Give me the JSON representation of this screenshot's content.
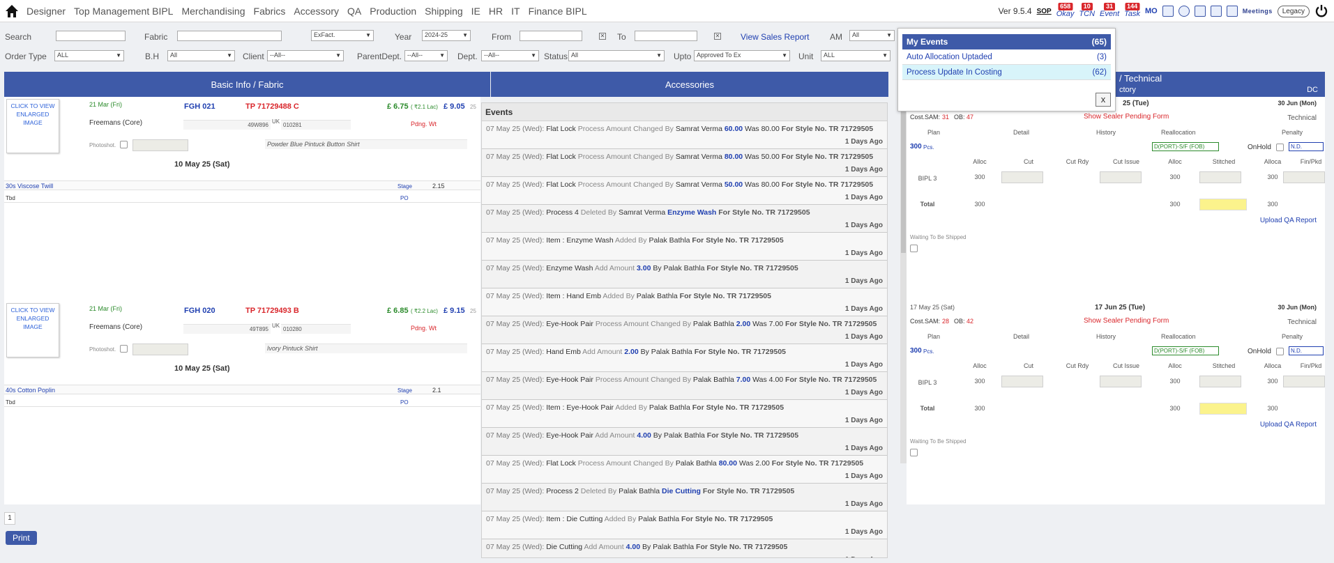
{
  "nav": {
    "items": [
      "Designer",
      "Top Management BIPL",
      "Merchandising",
      "Fabrics",
      "Accessory",
      "QA",
      "Production",
      "Shipping",
      "IE",
      "HR",
      "IT",
      "Finance BIPL"
    ],
    "version": "Ver 9.5.4",
    "sop": "SOP",
    "badges": [
      {
        "label": "Okay",
        "count": "658"
      },
      {
        "label": "TCN",
        "count": "10"
      },
      {
        "label": "Event",
        "count": "31"
      },
      {
        "label": "Task",
        "count": "144"
      }
    ],
    "mo": "MO",
    "meetings": "Meetings",
    "legacy": "Legacy"
  },
  "filters": {
    "search": "Search",
    "fabric": "Fabric",
    "exfact": "ExFact.",
    "year": "Year",
    "year_val": "2024-25",
    "from": "From",
    "to": "To",
    "view_sales": "View Sales Report",
    "am": "AM",
    "am_val": "All",
    "order_type": "Order Type",
    "order_type_val": "ALL",
    "bh": "B.H",
    "bh_val": "All",
    "client": "Client",
    "client_val": "--All--",
    "parent": "ParentDept.",
    "parent_val": "--All--",
    "dept": "Dept.",
    "dept_val": "--All--",
    "status": "Status",
    "status_val": "All",
    "upto": "Upto",
    "upto_val": "Approved To Ex",
    "unit": "Unit",
    "unit_val": "ALL"
  },
  "headers": {
    "basic": "Basic Info / Fabric",
    "acc": "Accessories",
    "tech": "/ Technical",
    "factory": "ctory",
    "dc": "DC"
  },
  "orders": [
    {
      "thumb": "CLICK TO VIEW ENLARGED IMAGE",
      "date": "21 Mar (Fri)",
      "code": "FGH 021",
      "tp": "TP 71729488 C",
      "price1": "£ 6.75",
      "price1_sub": "( ₹2.1 Lac)",
      "price2": "£ 9.05",
      "price2_sub": "25",
      "client": "Freemans (Core)",
      "ref": "49W896",
      "cty": "UK",
      "num": "010281",
      "pdng": "Pdng. Wt",
      "photoshot": "Photoshot.",
      "desc": "Powder Blue Pintuck Button Shirt",
      "exdate": "10 May 25 (Sat)",
      "fabric": "30s Viscose Twill",
      "stage": "Stage",
      "stage_val": "2.15",
      "tbd": "Tbd",
      "po": "PO",
      "t": {
        "d1": "",
        "d2": "25 (Tue)",
        "d3": "30 Jun (Mon)",
        "sam": "Cost.SAM:",
        "sam_v": "31",
        "ob": "OB:",
        "ob_v": "47",
        "sealer": "Show Sealer Pending Form",
        "tech": "Technical",
        "plan": "Plan",
        "detail": "Detail",
        "history": "History",
        "realloc": "Reallocation",
        "penalty": "Penalty",
        "pcs": "300",
        "pcs_u": "Pcs.",
        "dport": "D(PORT)-S/F (FOB)",
        "onhold": "OnHold",
        "nd": "N.D.",
        "cols": [
          "Alloc",
          "Cut",
          "Cut Rdy",
          "Cut Issue",
          "Alloc",
          "Stitched",
          "Alloca",
          "Fin/Pkd"
        ],
        "bipl": "BIPL 3",
        "v1": "300",
        "v2": "300",
        "v3": "300",
        "total": "Total",
        "tv1": "300",
        "tv2": "300",
        "tv3": "300",
        "upload": "Upload QA Report",
        "waiting": "Waiting To Be Shipped"
      }
    },
    {
      "thumb": "CLICK TO VIEW ENLARGED IMAGE",
      "date": "21 Mar (Fri)",
      "code": "FGH 020",
      "tp": "TP 71729493 B",
      "price1": "£ 6.85",
      "price1_sub": "( ₹2.2 Lac)",
      "price2": "£ 9.15",
      "price2_sub": "25",
      "client": "Freemans (Core)",
      "ref": "49T895",
      "cty": "UK",
      "num": "010280",
      "pdng": "Pdng. Wt",
      "photoshot": "Photoshot.",
      "desc": "Ivory Pintuck Shirt",
      "exdate": "10 May 25 (Sat)",
      "fabric": "40s Cotton Poplin",
      "stage": "Stage",
      "stage_val": "2.1",
      "tbd": "Tbd",
      "po": "PO",
      "t": {
        "d1": "17 May 25 (Sat)",
        "d2": "17 Jun 25 (Tue)",
        "d3": "30 Jun (Mon)",
        "sam": "Cost.SAM:",
        "sam_v": "28",
        "ob": "OB:",
        "ob_v": "42",
        "sealer": "Show Sealer Pending Form",
        "tech": "Technical",
        "plan": "Plan",
        "detail": "Detail",
        "history": "History",
        "realloc": "Reallocation",
        "penalty": "Penalty",
        "pcs": "300",
        "pcs_u": "Pcs.",
        "dport": "D(PORT)-S/F (FOB)",
        "onhold": "OnHold",
        "nd": "N.D.",
        "cols": [
          "Alloc",
          "Cut",
          "Cut Rdy",
          "Cut Issue",
          "Alloc",
          "Stitched",
          "Alloca",
          "Fin/Pkd"
        ],
        "bipl": "BIPL 3",
        "v1": "300",
        "v2": "300",
        "v3": "300",
        "total": "Total",
        "tv1": "300",
        "tv2": "300",
        "tv3": "300",
        "upload": "Upload QA Report",
        "waiting": "Waiting To Be Shipped"
      }
    }
  ],
  "events": {
    "title": "Events",
    "ago": "1 Days Ago",
    "items": [
      {
        "d": "07 May 25 (Wed):",
        "p1": "Flat Lock",
        "a": "Process Amount Changed By",
        "u": "Samrat Verma",
        "v": "60.00",
        "w": "Was 80.00",
        "s": "For Style No. TR 71729505"
      },
      {
        "d": "07 May 25 (Wed):",
        "p1": "Flat Lock",
        "a": "Process Amount Changed By",
        "u": "Samrat Verma",
        "v": "80.00",
        "w": "Was 50.00",
        "s": "For Style No. TR 71729505"
      },
      {
        "d": "07 May 25 (Wed):",
        "p1": "Flat Lock",
        "a": "Process Amount Changed By",
        "u": "Samrat Verma",
        "v": "50.00",
        "w": "Was 80.00",
        "s": "For Style No. TR 71729505"
      },
      {
        "d": "07 May 25 (Wed):",
        "p1": "Process 4",
        "a": "Deleted By",
        "u": "Samrat Verma",
        "v": "Enzyme Wash",
        "w": "",
        "s": "For Style No. TR 71729505"
      },
      {
        "d": "07 May 25 (Wed):",
        "p1": "Item : Enzyme Wash",
        "a": "Added By",
        "u": "Palak Bathla",
        "v": "",
        "w": "",
        "s": "For Style No. TR 71729505"
      },
      {
        "d": "07 May 25 (Wed):",
        "p1": "Enzyme Wash",
        "a": "Add Amount",
        "u": "",
        "v": "3.00",
        "w": "By Palak Bathla",
        "s": "For Style No. TR 71729505"
      },
      {
        "d": "07 May 25 (Wed):",
        "p1": "Item : Hand Emb",
        "a": "Added By",
        "u": "Palak Bathla",
        "v": "",
        "w": "",
        "s": "For Style No. TR 71729505"
      },
      {
        "d": "07 May 25 (Wed):",
        "p1": "Eye-Hook Pair",
        "a": "Process Amount Changed By",
        "u": "Palak Bathla",
        "v": "2.00",
        "w": "Was 7.00",
        "s": "For Style No. TR 71729505"
      },
      {
        "d": "07 May 25 (Wed):",
        "p1": "Hand Emb",
        "a": "Add Amount",
        "u": "",
        "v": "2.00",
        "w": "By Palak Bathla",
        "s": "For Style No. TR 71729505"
      },
      {
        "d": "07 May 25 (Wed):",
        "p1": "Eye-Hook Pair",
        "a": "Process Amount Changed By",
        "u": "Palak Bathla",
        "v": "7.00",
        "w": "Was 4.00",
        "s": "For Style No. TR 71729505"
      },
      {
        "d": "07 May 25 (Wed):",
        "p1": "Item : Eye-Hook Pair",
        "a": "Added By",
        "u": "Palak Bathla",
        "v": "",
        "w": "",
        "s": "For Style No. TR 71729505"
      },
      {
        "d": "07 May 25 (Wed):",
        "p1": "Eye-Hook Pair",
        "a": "Add Amount",
        "u": "",
        "v": "4.00",
        "w": "By Palak Bathla",
        "s": "For Style No. TR 71729505"
      },
      {
        "d": "07 May 25 (Wed):",
        "p1": "Flat Lock",
        "a": "Process Amount Changed By",
        "u": "Palak Bathla",
        "v": "80.00",
        "w": "Was 2.00",
        "s": "For Style No. TR 71729505"
      },
      {
        "d": "07 May 25 (Wed):",
        "p1": "Process 2",
        "a": "Deleted By",
        "u": "Palak Bathla",
        "v": "Die Cutting",
        "w": "",
        "s": "For Style No. TR 71729505"
      },
      {
        "d": "07 May 25 (Wed):",
        "p1": "Item : Die Cutting",
        "a": "Added By",
        "u": "Palak Bathla",
        "v": "",
        "w": "",
        "s": "For Style No. TR 71729505"
      },
      {
        "d": "07 May 25 (Wed):",
        "p1": "Die Cutting",
        "a": "Add Amount",
        "u": "",
        "v": "4.00",
        "w": "By Palak Bathla",
        "s": "For Style No. TR 71729505"
      }
    ]
  },
  "myevents": {
    "title": "My Events",
    "count": "(65)",
    "items": [
      {
        "label": "Auto Allocation Uptaded",
        "count": "(3)"
      },
      {
        "label": "Process Update In Costing",
        "count": "(62)"
      }
    ],
    "close": "x"
  },
  "pager": "1",
  "print": "Print"
}
